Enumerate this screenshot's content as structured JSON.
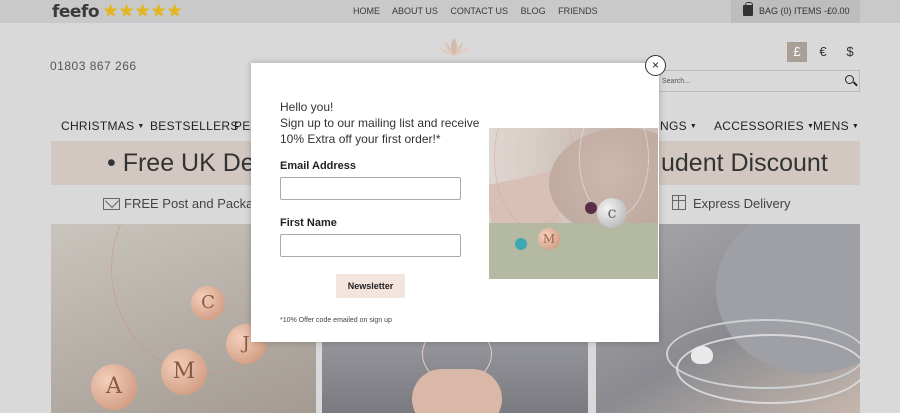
{
  "topbar": {
    "brand": "feefo",
    "stars": "★★★★★",
    "nav": [
      "HOME",
      "ABOUT US",
      "CONTACT US",
      "BLOG",
      "FRIENDS"
    ],
    "bag": "BAG (0) ITEMS -£0.00"
  },
  "header": {
    "phone": "01803 867 266",
    "currencies": [
      "£",
      "€",
      "$"
    ],
    "search_placeholder": "Search..."
  },
  "menu": {
    "items": [
      {
        "label": "CHRISTMAS",
        "dropdown": true
      },
      {
        "label": "BESTSELLERS",
        "dropdown": false
      },
      {
        "label": "PER",
        "dropdown": false
      },
      {
        "label": "NGS",
        "dropdown": true
      },
      {
        "label": "ACCESSORIES",
        "dropdown": true
      },
      {
        "label": "MENS",
        "dropdown": true
      }
    ]
  },
  "banner": {
    "left": "• Free UK De",
    "right": "udent Discount"
  },
  "usp": {
    "left": "FREE Post and Packagi",
    "right": "Express Delivery"
  },
  "product_initials": {
    "disc1": "A",
    "disc2": "M",
    "disc3": "C",
    "disc4": "J"
  },
  "modal": {
    "intro_line1": "Hello you!",
    "intro_line2": "Sign up to our mailing list and receive",
    "intro_line3": "10% Extra off your first order!*",
    "email_label": "Email Address",
    "first_name_label": "First Name",
    "button": "Newsletter",
    "fineprint": "*10% Offer code emailed on sign up",
    "close": "×"
  },
  "colors": {
    "banner_bg": "#d3c7c2",
    "button_bg": "#f3e4dd",
    "stars": "#e3b61f"
  }
}
